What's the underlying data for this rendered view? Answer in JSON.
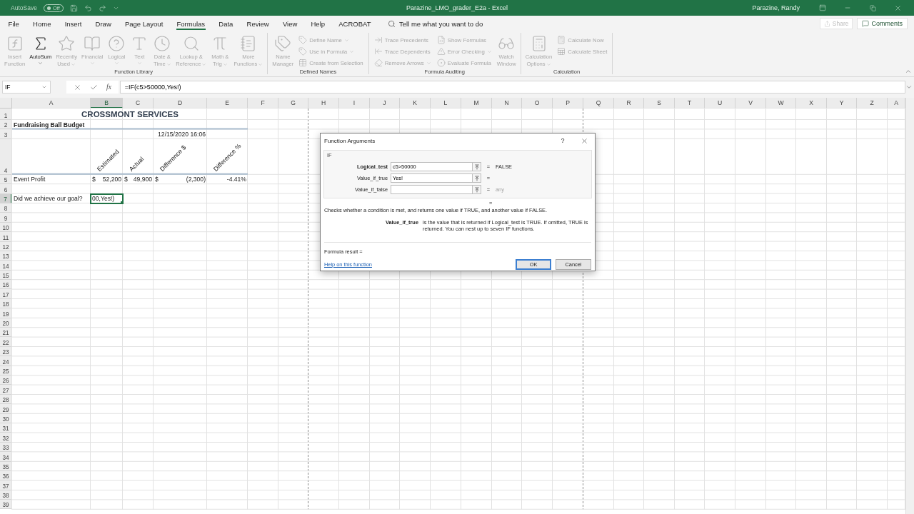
{
  "title_bar": {
    "autosave_label": "AutoSave",
    "autosave_state": "Off",
    "document_title": "Parazine_LMO_grader_E2a  -  Excel",
    "user": "Parazine, Randy"
  },
  "tabs": [
    {
      "label": "File",
      "selected": false
    },
    {
      "label": "Home",
      "selected": false
    },
    {
      "label": "Insert",
      "selected": false
    },
    {
      "label": "Draw",
      "selected": false
    },
    {
      "label": "Page Layout",
      "selected": false
    },
    {
      "label": "Formulas",
      "selected": true
    },
    {
      "label": "Data",
      "selected": false
    },
    {
      "label": "Review",
      "selected": false
    },
    {
      "label": "View",
      "selected": false
    },
    {
      "label": "Help",
      "selected": false
    },
    {
      "label": "ACROBAT",
      "selected": false
    }
  ],
  "tell_me": {
    "placeholder": "Tell me what you want to do"
  },
  "share": {
    "label": "Share",
    "disabled": true
  },
  "comments": {
    "label": "Comments"
  },
  "ribbon": {
    "groups": [
      {
        "label": "Function Library",
        "items": [
          {
            "kind": "large",
            "lines": [
              "Insert",
              "Function"
            ],
            "disabled": true,
            "dropdown": false
          },
          {
            "kind": "large",
            "lines": [
              "AutoSum"
            ],
            "disabled": false,
            "dropdown": true
          },
          {
            "kind": "large",
            "lines": [
              "Recently",
              "Used"
            ],
            "disabled": true,
            "dropdown": true
          },
          {
            "kind": "large",
            "lines": [
              "Financial"
            ],
            "disabled": true,
            "dropdown": true
          },
          {
            "kind": "large",
            "lines": [
              "Logical"
            ],
            "disabled": true,
            "dropdown": true
          },
          {
            "kind": "large",
            "lines": [
              "Text"
            ],
            "disabled": true,
            "dropdown": true
          },
          {
            "kind": "large",
            "lines": [
              "Date &",
              "Time"
            ],
            "disabled": true,
            "dropdown": true
          },
          {
            "kind": "large",
            "lines": [
              "Lookup &",
              "Reference"
            ],
            "disabled": true,
            "dropdown": true
          },
          {
            "kind": "large",
            "lines": [
              "Math &",
              "Trig"
            ],
            "disabled": true,
            "dropdown": true
          },
          {
            "kind": "large",
            "lines": [
              "More",
              "Functions"
            ],
            "disabled": true,
            "dropdown": true
          }
        ]
      },
      {
        "label": "Defined Names",
        "items": [
          {
            "kind": "large",
            "lines": [
              "Name",
              "Manager"
            ],
            "disabled": true,
            "dropdown": false
          },
          {
            "kind": "stack",
            "buttons": [
              {
                "label": "Define Name",
                "disabled": true,
                "dropdown": true
              },
              {
                "label": "Use in Formula",
                "disabled": true,
                "dropdown": true
              },
              {
                "label": "Create from Selection",
                "disabled": true,
                "dropdown": false
              }
            ]
          }
        ]
      },
      {
        "label": "Formula Auditing",
        "items": [
          {
            "kind": "stack",
            "buttons": [
              {
                "label": "Trace Precedents",
                "disabled": true,
                "dropdown": false
              },
              {
                "label": "Trace Dependents",
                "disabled": true,
                "dropdown": false
              },
              {
                "label": "Remove Arrows",
                "disabled": true,
                "dropdown": true
              }
            ]
          },
          {
            "kind": "stack",
            "buttons": [
              {
                "label": "Show Formulas",
                "disabled": true,
                "dropdown": false
              },
              {
                "label": "Error Checking",
                "disabled": true,
                "dropdown": true
              },
              {
                "label": "Evaluate Formula",
                "disabled": true,
                "dropdown": false
              }
            ]
          },
          {
            "kind": "large",
            "lines": [
              "Watch",
              "Window"
            ],
            "disabled": true,
            "dropdown": false
          }
        ]
      },
      {
        "label": "Calculation",
        "items": [
          {
            "kind": "large",
            "lines": [
              "Calculation",
              "Options"
            ],
            "disabled": true,
            "dropdown": true
          },
          {
            "kind": "stack",
            "buttons": [
              {
                "label": "Calculate Now",
                "disabled": true,
                "dropdown": false
              },
              {
                "label": "Calculate Sheet",
                "disabled": true,
                "dropdown": false
              }
            ]
          }
        ]
      }
    ]
  },
  "formula_bar": {
    "name_box": "IF",
    "insert_function_glyph": "fx",
    "formula": "=IF(c5>50000,Yes!)"
  },
  "sheet": {
    "columns": [
      "A",
      "B",
      "C",
      "D",
      "E",
      "F",
      "G",
      "H",
      "I",
      "J",
      "K",
      "L",
      "M",
      "N",
      "O",
      "P",
      "Q",
      "R",
      "S",
      "T",
      "U",
      "V",
      "W",
      "X",
      "Y",
      "Z",
      "A"
    ],
    "rows": [
      {
        "label": "1",
        "underlined": false,
        "cells": [
          {
            "kind": "title",
            "text": "CROSSMONT SERVICES",
            "selected": false
          }
        ]
      },
      {
        "label": "2",
        "underlined": true,
        "cells": [
          {
            "kind": "label",
            "text": "Fundraising Ball Budget",
            "bold": true,
            "selected": false
          }
        ]
      },
      {
        "label": "3",
        "underlined": false,
        "cells": [
          {
            "kind": "empty",
            "selected": false
          },
          {
            "kind": "empty",
            "selected": false
          },
          {
            "kind": "empty",
            "selected": false
          },
          {
            "kind": "number",
            "text": "12/15/2020 16:06",
            "selected": false
          }
        ]
      },
      {
        "label": "4",
        "underlined": true,
        "cells": [
          {
            "kind": "empty",
            "selected": false
          },
          {
            "kind": "rotated",
            "text": "Estimated",
            "selected": false
          },
          {
            "kind": "rotated",
            "text": "Actual",
            "selected": false
          },
          {
            "kind": "rotated",
            "text": "Difference $",
            "selected": false
          },
          {
            "kind": "rotated",
            "text": "Difference %",
            "selected": false
          }
        ]
      },
      {
        "label": "5",
        "underlined": false,
        "cells": [
          {
            "kind": "label",
            "text": "Event Profit",
            "selected": false
          },
          {
            "kind": "currency",
            "symbol": "$",
            "text": "52,200",
            "selected": false
          },
          {
            "kind": "currency",
            "symbol": "$",
            "text": "49,900",
            "selected": false
          },
          {
            "kind": "currency",
            "symbol": "$",
            "text": "(2,300)",
            "selected": false
          },
          {
            "kind": "number",
            "text": "-4.41%",
            "selected": false
          }
        ]
      },
      {
        "label": "6",
        "underlined": false
      },
      {
        "label": "7",
        "underlined": false,
        "cells": [
          {
            "kind": "label",
            "text": "Did we achieve our goal?",
            "selected": false
          },
          {
            "kind": "editing",
            "text": "00,Yes!)",
            "selected": true
          }
        ]
      },
      {
        "label": "8"
      },
      {
        "label": "9"
      },
      {
        "label": "10"
      },
      {
        "label": "11"
      },
      {
        "label": "12"
      },
      {
        "label": "13"
      },
      {
        "label": "14"
      },
      {
        "label": "15"
      },
      {
        "label": "16"
      },
      {
        "label": "17"
      },
      {
        "label": "18"
      },
      {
        "label": "19"
      },
      {
        "label": "20"
      },
      {
        "label": "21"
      },
      {
        "label": "22"
      },
      {
        "label": "23"
      },
      {
        "label": "24"
      },
      {
        "label": "25"
      },
      {
        "label": "26"
      },
      {
        "label": "27"
      },
      {
        "label": "28"
      },
      {
        "label": "29"
      },
      {
        "label": "30"
      },
      {
        "label": "31"
      },
      {
        "label": "32"
      },
      {
        "label": "33"
      },
      {
        "label": "34"
      },
      {
        "label": "35"
      },
      {
        "label": "36"
      },
      {
        "label": "37"
      },
      {
        "label": "38"
      },
      {
        "label": "39"
      }
    ]
  },
  "dialog": {
    "title": "Function Arguments",
    "help": "?",
    "function_name": "IF",
    "arguments": [
      {
        "name": "Logical_test",
        "required": true,
        "value": "c5>50000",
        "equals": "=",
        "result": "FALSE",
        "result_muted": false
      },
      {
        "name": "Value_if_true",
        "required": false,
        "value": "Yes!",
        "equals": "="
      },
      {
        "name": "Value_if_false",
        "required": false,
        "equals": "=",
        "result": "any",
        "result_muted": true
      }
    ],
    "result_equals": "=",
    "description": "Checks whether a condition is met, and returns one value if TRUE, and another value if FALSE.",
    "argument_help": {
      "name": "Value_if_true",
      "text": "is the value that is returned if Logical_test is TRUE. If omitted, TRUE is returned. You can nest up to seven IF functions."
    },
    "formula_result": "Formula result =",
    "help_link": "Help on this function",
    "buttons": [
      {
        "label": "OK",
        "default": true
      },
      {
        "label": "Cancel",
        "default": false
      }
    ]
  }
}
